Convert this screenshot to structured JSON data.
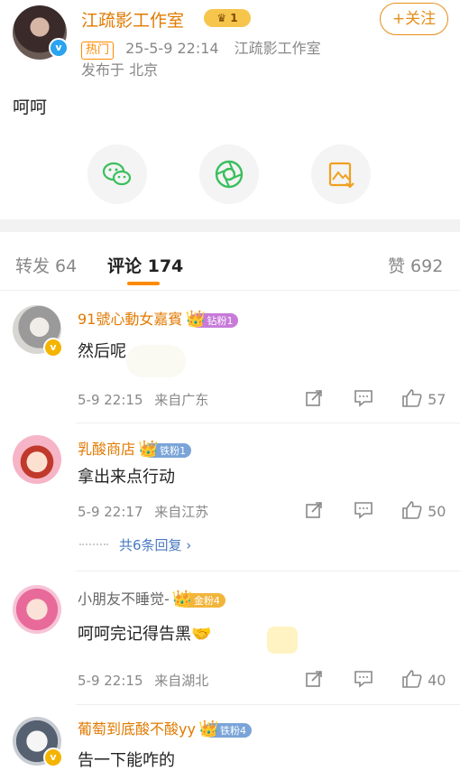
{
  "post": {
    "author": "江疏影工作室",
    "level_badge": "1",
    "follow_label": "+关注",
    "hot_tag": "热门",
    "time": "25-5-9 22:14",
    "source": "江疏影工作室",
    "location": "发布于 北京",
    "text": "呵呵"
  },
  "share": {
    "items": [
      {
        "icon": "wechat-icon",
        "color": "#3bbf5d"
      },
      {
        "icon": "moments-icon",
        "color": "#3bbf5d"
      },
      {
        "icon": "save-image-icon",
        "color": "#f0a020"
      }
    ]
  },
  "tabs": {
    "repost": "转发 64",
    "comments": "评论 174",
    "likes": "赞 692"
  },
  "comments": [
    {
      "name": "91號心動女嘉賓",
      "fan_badge": "钻粉1",
      "fan_color": "#c77ad8",
      "text": "然后呢",
      "time": "5-9 22:15",
      "from": "来自广东",
      "likes": "57"
    },
    {
      "name": "乳酸商店",
      "fan_badge": "铁粉1",
      "fan_color": "#7aa4d8",
      "text": "拿出来点行动",
      "time": "5-9 22:17",
      "from": "来自江苏",
      "likes": "50",
      "replies": "共6条回复 ›"
    },
    {
      "name": "小朋友不睡觉-",
      "fan_badge": "金粉4",
      "fan_color": "#f2b53a",
      "text": "呵呵完记得告黑🤝",
      "time": "5-9 22:15",
      "from": "来自湖北",
      "likes": "40"
    },
    {
      "name": "葡萄到底酸不酸yy",
      "fan_badge": "铁粉4",
      "fan_color": "#7aa4d8",
      "text": "告一下能咋的"
    }
  ]
}
